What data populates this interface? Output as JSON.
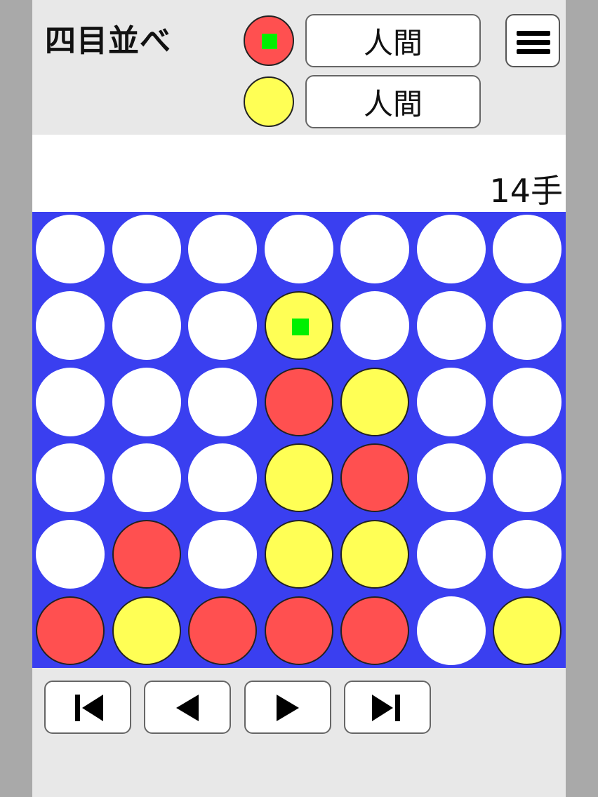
{
  "header": {
    "title": "四目並べ",
    "player1": {
      "color": "#ff5050",
      "label": "人間"
    },
    "player2": {
      "color": "#ffff55",
      "label": "人間"
    }
  },
  "status": {
    "move_count": "14手"
  },
  "board": {
    "rows": 6,
    "cols": 7,
    "cells": [
      [
        "empty",
        "empty",
        "empty",
        "empty",
        "empty",
        "empty",
        "empty"
      ],
      [
        "empty",
        "empty",
        "empty",
        "yellow",
        "empty",
        "empty",
        "empty"
      ],
      [
        "empty",
        "empty",
        "empty",
        "red",
        "yellow",
        "empty",
        "empty"
      ],
      [
        "empty",
        "empty",
        "empty",
        "yellow",
        "red",
        "empty",
        "empty"
      ],
      [
        "empty",
        "red",
        "empty",
        "yellow",
        "yellow",
        "empty",
        "empty"
      ],
      [
        "red",
        "yellow",
        "red",
        "red",
        "red",
        "empty",
        "yellow"
      ]
    ],
    "last_move": {
      "row": 1,
      "col": 3
    },
    "colors": {
      "board": "#3a3ff0",
      "red": "#ff5050",
      "yellow": "#ffff55",
      "last_move_marker": "#00f000"
    }
  },
  "nav": {
    "icons": [
      "skip-to-start-icon",
      "step-back-icon",
      "step-forward-icon",
      "skip-to-end-icon"
    ]
  }
}
